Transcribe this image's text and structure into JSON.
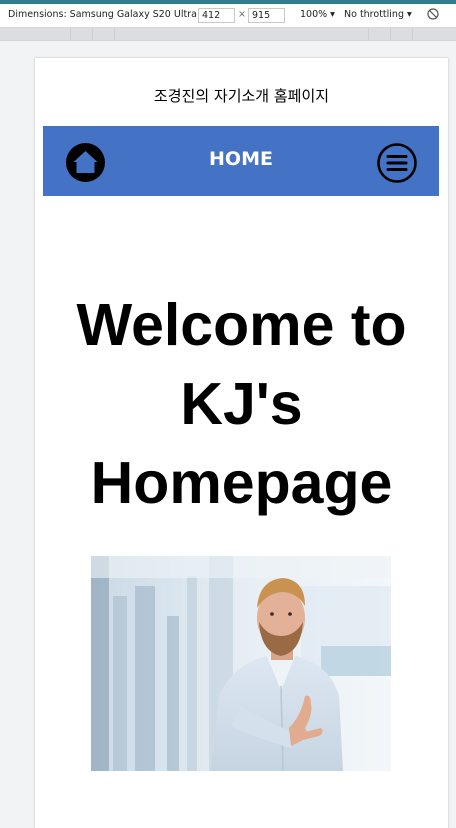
{
  "devtools": {
    "dimensions_label": "Dimensions: Samsung Galaxy S20 Ultra ▾",
    "width_value": "412",
    "times": "×",
    "height_value": "915",
    "zoom": "100% ▾",
    "throttle": "No throttling ▾",
    "rotate_icon": "rotate-icon"
  },
  "page": {
    "site_title": "조경진의 자기소개 홈페이지",
    "nav": {
      "title": "HOME",
      "home_icon": "home-icon",
      "menu_icon": "hamburger-menu-icon",
      "bg_color": "#4472c4"
    },
    "hero": {
      "line1": "Welcome to",
      "line2": "KJ's",
      "line3": "Homepage"
    },
    "photo": "man-offering-handshake-photo"
  }
}
